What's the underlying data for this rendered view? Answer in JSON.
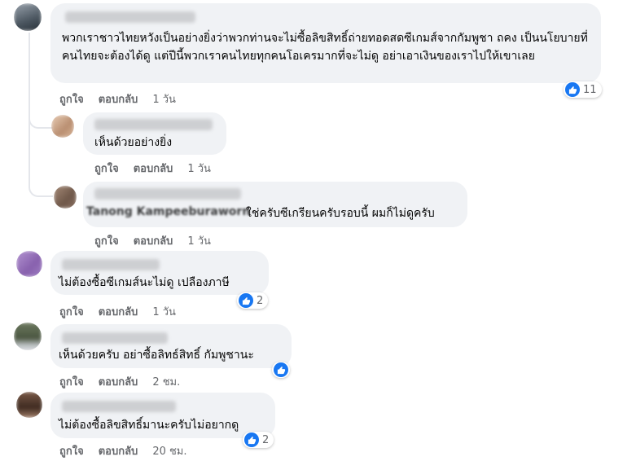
{
  "like_label": "ถูกใจ",
  "reply_label": "ตอบกลับ",
  "comments": [
    {
      "text": "พวกเราชาวไทยหวังเป็นอย่างยิ่งว่าพวกท่านจะไม่ซื้อลิขสิทธิ์ถ่ายทอดสดซีเกมส์จากกัมพูชา ถคง เป็นนโยบายที่คนไทยจะต้องได้ดู แต่ปีนี้พวกเราคนไทยทุกคนโอเครมากที่จะไม่ดู อย่าเอาเงินของเราไปให้เขาเลย",
      "time": "1 วัน",
      "reactions": "11"
    },
    {
      "text": "เห็นด้วยอย่างยิ่ง",
      "time": "1 วัน",
      "reactions": ""
    },
    {
      "author_partial": "Tanong Kampeeburaworn",
      "text": "ใช่ครับซีเกรียนครับรอบนี้ ผมก็ไม่ดูครับ",
      "time": "1 วัน",
      "reactions": ""
    },
    {
      "text": "ไม่ต้องซื้อซีเกมส์นะไม่ดู เปลืองภาษี",
      "time": "1 วัน",
      "reactions": "2"
    },
    {
      "text": "เห็นด้วยครับ อย่าซื้อลิทธ์สิทธิ์ กัมพูชานะ",
      "time": "2 ชม.",
      "reactions": ""
    },
    {
      "text": "ไม่ต้องซื้อลิขสิทธิ์มานะครับไม่อยากดู",
      "time": "20 ชม.",
      "reactions": "2"
    }
  ],
  "colors": {
    "bubble": "#f0f2f5",
    "like_blue": "#1877f2",
    "meta_gray": "#65676b"
  }
}
